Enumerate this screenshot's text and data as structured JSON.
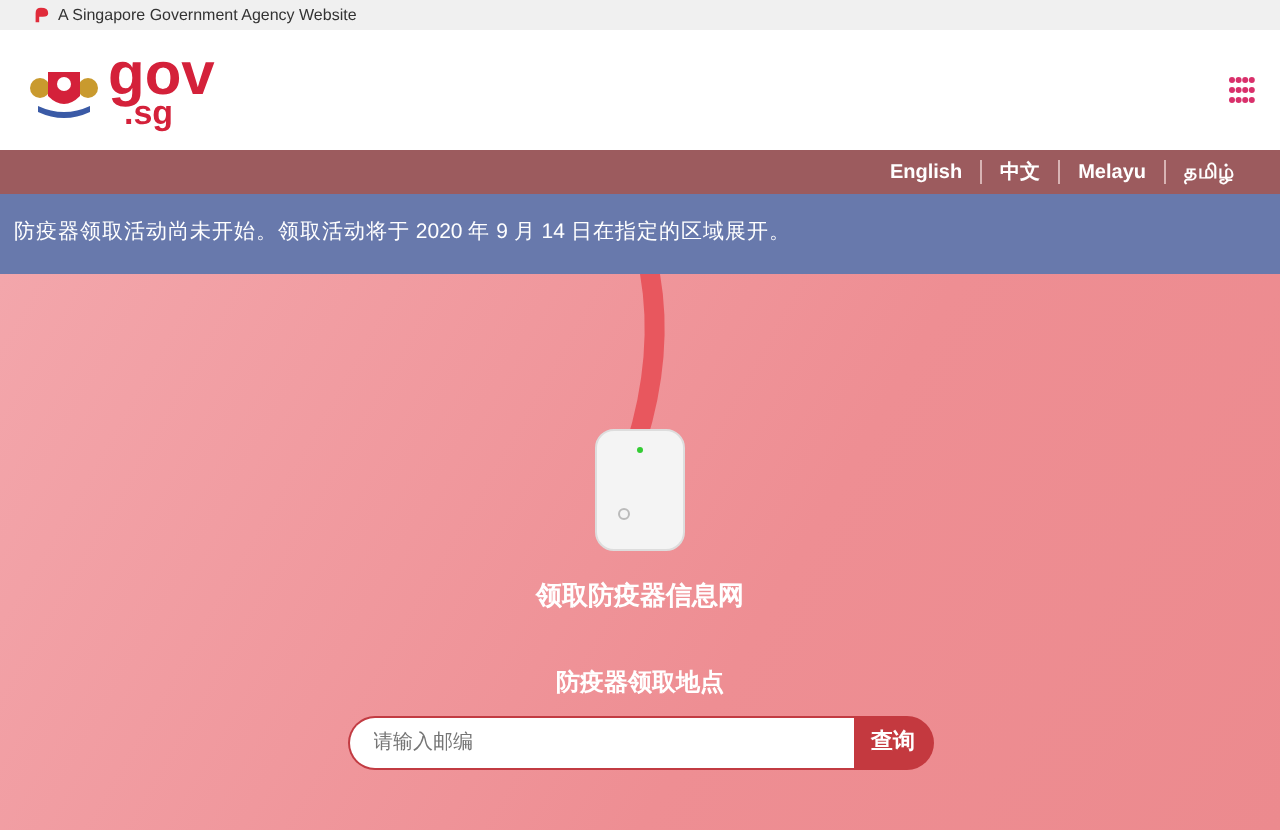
{
  "masthead": {
    "text": "A Singapore Government Agency Website"
  },
  "header": {
    "logo_text": "gov",
    "logo_suffix": ".sg"
  },
  "languages": [
    "English",
    "中文",
    "Melayu",
    "தமிழ்"
  ],
  "notice": "防疫器领取活动尚未开始。领取活动将于 2020 年 9 月 14 日在指定的区域展开。",
  "hero": {
    "title": "领取防疫器信息网",
    "subtitle": "防疫器领取地点",
    "search": {
      "placeholder": "请输入邮编",
      "button": "查询"
    }
  }
}
